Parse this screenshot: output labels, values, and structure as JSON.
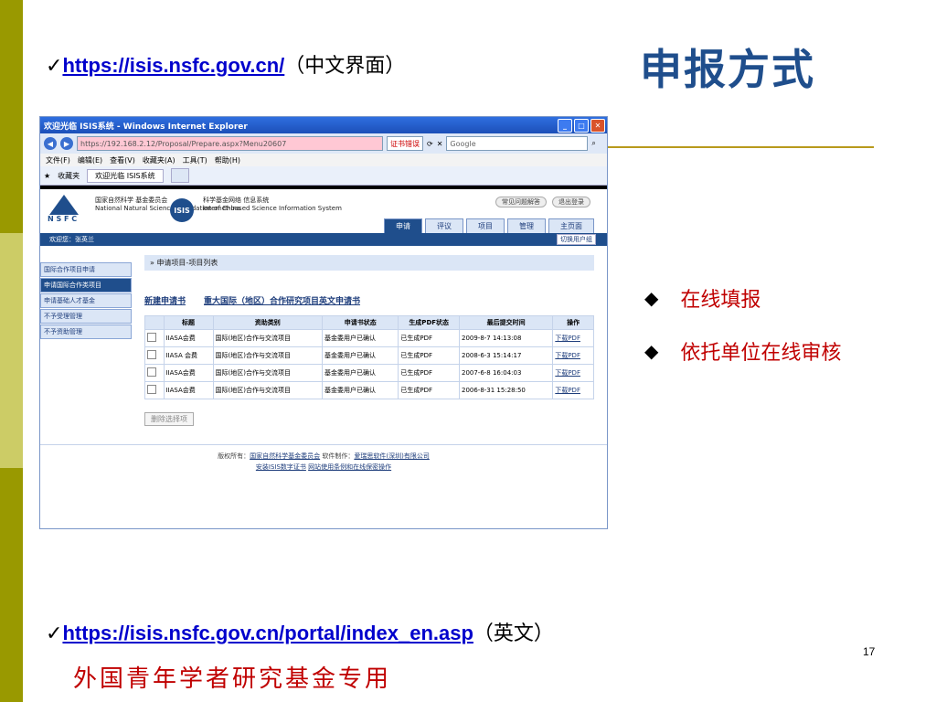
{
  "slide": {
    "top_url": "https://isis.nsfc.gov.cn/",
    "top_note": "（中文界面）",
    "title": "申报方式",
    "bullets": [
      "在线填报",
      "依托单位在线审核"
    ],
    "bottom_url": "https://isis.nsfc.gov.cn/portal/index_en.asp",
    "bottom_note": "（英文）",
    "bottom_caption": "外国青年学者研究基金专用",
    "page_number": "17",
    "check_mark": "✓",
    "bullet_mark": "◆"
  },
  "browser": {
    "window_title": "欢迎光临 ISIS系统 - Windows Internet Explorer",
    "address": "https://192.168.2.12/Proposal/Prepare.aspx?Menu20607",
    "cert_text": "证书错误",
    "search_engine": "Google",
    "menu": [
      "文件(F)",
      "编辑(E)",
      "查看(V)",
      "收藏夹(A)",
      "工具(T)",
      "帮助(H)"
    ],
    "favorites_label": "收藏夹",
    "tab_title": "欢迎光临 ISIS系统"
  },
  "isis": {
    "nsfc_abbr": "N S F C",
    "nsfc_cn": "国家自然科学 基金委员会",
    "nsfc_en": "National Natural Science Foundation of China",
    "isis_logo": "ISIS",
    "isis_cn": "科学基金网络 信息系统",
    "isis_en": "Internet-based Science Information System",
    "top_buttons": [
      "常见问题解答",
      "退出登录"
    ],
    "tabs": [
      "申请",
      "评议",
      "项目",
      "管理",
      "主页面"
    ],
    "welcome": "欢迎您：张英兰",
    "switch_user": "切换用户组",
    "sidebar": [
      "国际合作项目申请",
      "申请国际合作类项目",
      "申请基础人才基金",
      "不予受理管理",
      "不予资助管理"
    ],
    "breadcrumb": "» 申请项目-项目列表",
    "new_links": [
      "新建申请书",
      "重大国际（地区）合作研究项目英文申请书"
    ],
    "table_headers": [
      "",
      "标题",
      "资助类别",
      "申请书状态",
      "生成PDF状态",
      "最后提交时间",
      "操作"
    ],
    "rows": [
      [
        "IIASA会费",
        "国际(地区)合作与交流项目",
        "基金委用户已确认",
        "已生成PDF",
        "2009-8-7 14:13:08",
        "下载PDF"
      ],
      [
        "IIASA 会费",
        "国际(地区)合作与交流项目",
        "基金委用户已确认",
        "已生成PDF",
        "2008-6-3 15:14:17",
        "下载PDF"
      ],
      [
        "IIASA会费",
        "国际(地区)合作与交流项目",
        "基金委用户已确认",
        "已生成PDF",
        "2007-6-8 16:04:03",
        "下载PDF"
      ],
      [
        "IIASA会费",
        "国际(地区)合作与交流项目",
        "基金委用户已确认",
        "已生成PDF",
        "2006-8-31 15:28:50",
        "下载PDF"
      ]
    ],
    "delete_button": "删除选择项",
    "footer_line1_prefix": "版权所有：",
    "footer_owner": "国家自然科学基金委员会",
    "footer_dev_prefix": "软件制作：",
    "footer_dev": "爱瑞思软件(深圳)有限公司",
    "footer_link1": "安装ISIS数字证书",
    "footer_link2": "网站使用条例和在线保密操作"
  }
}
